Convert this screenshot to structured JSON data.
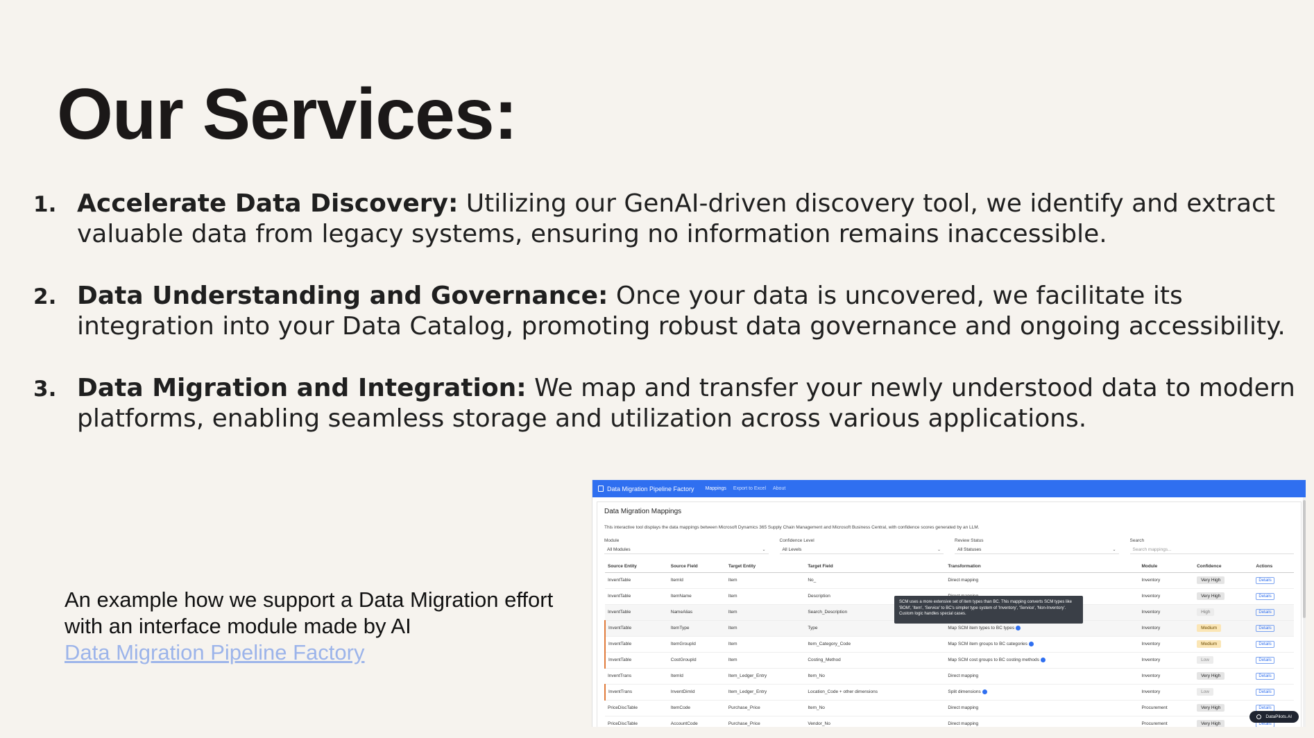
{
  "title": "Our Services:",
  "services": [
    {
      "num": "1.",
      "heading": "Accelerate Data Discovery:",
      "text": " Utilizing our GenAI-driven discovery tool, we identify and extract valuable data from legacy systems, ensuring no information remains inaccessible."
    },
    {
      "num": "2.",
      "heading": "Data Understanding and Governance:",
      "text": " Once your data is uncovered, we facilitate its integration into your Data Catalog, promoting robust data governance and ongoing accessibility."
    },
    {
      "num": "3.",
      "heading": "Data Migration and Integration:",
      "text": " We map and transfer your newly understood data to modern platforms, enabling seamless storage and utilization across various applications."
    }
  ],
  "caption": {
    "line1": "An example how we support a Data Migration effort",
    "line2": "with an interface module made by AI",
    "link": "Data Migration Pipeline Factory"
  },
  "app": {
    "brand": "Data Migration Pipeline Factory",
    "nav": [
      "Mappings",
      "Export to Excel",
      "About"
    ],
    "panel_title": "Data Migration Mappings",
    "description": "This interactive tool displays the data mappings between Microsoft Dynamics 365 Supply Chain Management and Microsoft Business Central, with confidence scores generated by an LLM.",
    "filters": [
      {
        "label": "Module",
        "value": "All Modules"
      },
      {
        "label": "Confidence Level",
        "value": "All Levels"
      },
      {
        "label": "Review Status",
        "value": "All Statuses"
      },
      {
        "label": "Search",
        "placeholder": "Search mappings..."
      }
    ],
    "columns": [
      "Source Entity",
      "Source Field",
      "Target Entity",
      "Target Field",
      "Transformation",
      "Module",
      "Confidence",
      "Actions"
    ],
    "rows": [
      [
        "InventTable",
        "ItemId",
        "Item",
        "No_",
        "Direct mapping",
        "Inventory",
        "Very High"
      ],
      [
        "InventTable",
        "ItemName",
        "Item",
        "Description",
        "Direct mapping",
        "Inventory",
        "Very High"
      ],
      [
        "InventTable",
        "NameAlias",
        "Item",
        "Search_Description",
        "",
        "Inventory",
        "High"
      ],
      [
        "InventTable",
        "ItemType",
        "Item",
        "Type",
        "Map SCM item types to BC types",
        "Inventory",
        "Medium"
      ],
      [
        "InventTable",
        "ItemGroupId",
        "Item",
        "Item_Category_Code",
        "Map SCM item groups to BC categories",
        "Inventory",
        "Medium"
      ],
      [
        "InventTable",
        "CostGroupId",
        "Item",
        "Costing_Method",
        "Map SCM cost groups to BC costing methods",
        "Inventory",
        "Low"
      ],
      [
        "InventTrans",
        "ItemId",
        "Item_Ledger_Entry",
        "Item_No",
        "Direct mapping",
        "Inventory",
        "Very High"
      ],
      [
        "InventTrans",
        "InventDimId",
        "Item_Ledger_Entry",
        "Location_Code + other dimensions",
        "Split dimensions",
        "Inventory",
        "Low"
      ],
      [
        "PriceDiscTable",
        "ItemCode",
        "Purchase_Price",
        "Item_No",
        "Direct mapping",
        "Procurement",
        "Very High"
      ],
      [
        "PriceDiscTable",
        "AccountCode",
        "Purchase_Price",
        "Vendor_No",
        "Direct mapping",
        "Procurement",
        "Very High"
      ]
    ],
    "details_label": "Details",
    "tooltip": "SCM uses a more extensive set of item types than BC. This mapping converts SCM types like 'BOM', 'Item', 'Service' to BC's simpler type system of 'Inventory', 'Service', 'Non-Inventory'. Custom logic handles special cases.",
    "badge": "DataPilots.AI"
  }
}
